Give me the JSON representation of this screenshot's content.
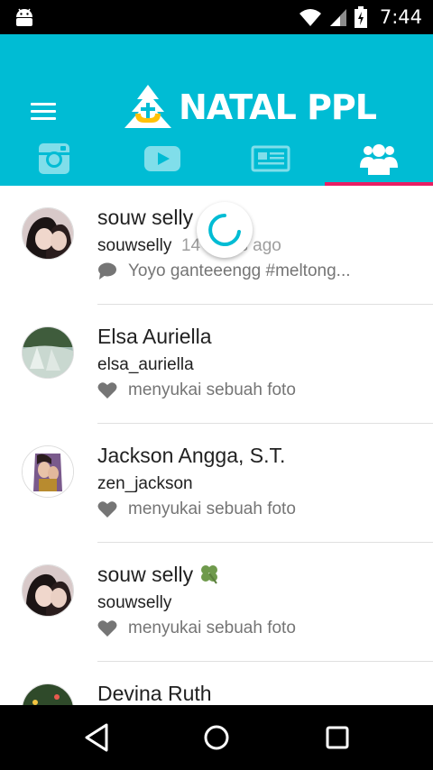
{
  "status_bar": {
    "time": "7:44"
  },
  "header": {
    "logo_text": "NATAL PPL"
  },
  "tabs": [
    {
      "icon": "instagram-icon",
      "active": false
    },
    {
      "icon": "youtube-icon",
      "active": false
    },
    {
      "icon": "news-icon",
      "active": false
    },
    {
      "icon": "group-icon",
      "active": true
    }
  ],
  "colors": {
    "primary": "#00BCD4",
    "accent": "#E91E63",
    "spinner": "#00BCD4"
  },
  "feed": [
    {
      "name": "souw selly",
      "username": "souwselly",
      "time": "14 hours ago",
      "activity_icon": "comment-icon",
      "activity": "Yoyo ganteeengg #meltong..."
    },
    {
      "name": "Elsa Auriella",
      "username": "elsa_auriella",
      "time": "",
      "activity_icon": "heart-icon",
      "activity": "menyukai sebuah foto"
    },
    {
      "name": "Jackson Angga, S.T.",
      "username": "zen_jackson",
      "time": "",
      "activity_icon": "heart-icon",
      "activity": "menyukai sebuah foto"
    },
    {
      "name": "souw selly",
      "username": "souwselly",
      "time": "",
      "activity_icon": "heart-icon",
      "activity": "menyukai sebuah foto"
    },
    {
      "name": "Devina Ruth",
      "username": "",
      "time": "",
      "activity_icon": "",
      "activity": ""
    }
  ]
}
